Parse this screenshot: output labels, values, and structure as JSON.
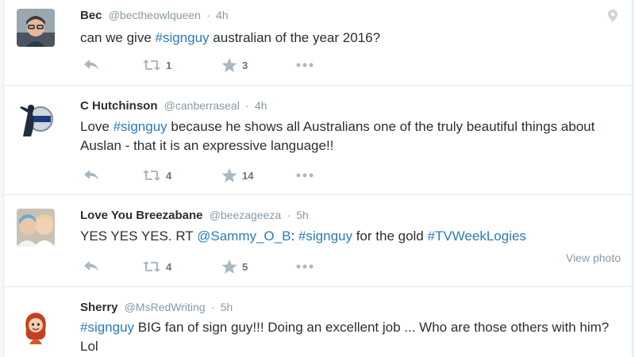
{
  "tweets": [
    {
      "name": "Bec",
      "handle": "@bectheowlqueen",
      "time": "4h",
      "text_parts": [
        "can we give ",
        "#signguy",
        " australian of the year 2016?"
      ],
      "retweets": "1",
      "likes": "3"
    },
    {
      "name": "C Hutchinson",
      "handle": "@canberraseal",
      "time": "4h",
      "text_parts": [
        "Love ",
        "#signguy",
        " because he shows all Australians one of the truly beautiful things about Auslan - that it is an expressive language!!"
      ],
      "retweets": "4",
      "likes": "14"
    },
    {
      "name": "Love You Breezabane",
      "handle": "@beezageeza",
      "time": "5h",
      "text_parts": [
        "YES YES YES. RT ",
        "@Sammy_O_B",
        ": ",
        "#signguy",
        " for the gold ",
        "#TVWeekLogies"
      ],
      "retweets": "4",
      "likes": "5",
      "view_photo": "View photo"
    },
    {
      "name": "Sherry",
      "handle": "@MsRedWriting",
      "time": "5h",
      "text_parts": [
        "#signguy",
        " BIG fan of sign guy!!! Doing an excellent job ... Who are those others with him? Lol"
      ]
    }
  ],
  "separator": "·",
  "icons": [
    "reply-icon",
    "retweet-icon",
    "like-icon",
    "more-icon",
    "location-pin-icon"
  ],
  "colors": {
    "link": "#2b7bb9",
    "muted": "#8899a6",
    "icon": "#aab8c2",
    "text": "#292f33"
  }
}
